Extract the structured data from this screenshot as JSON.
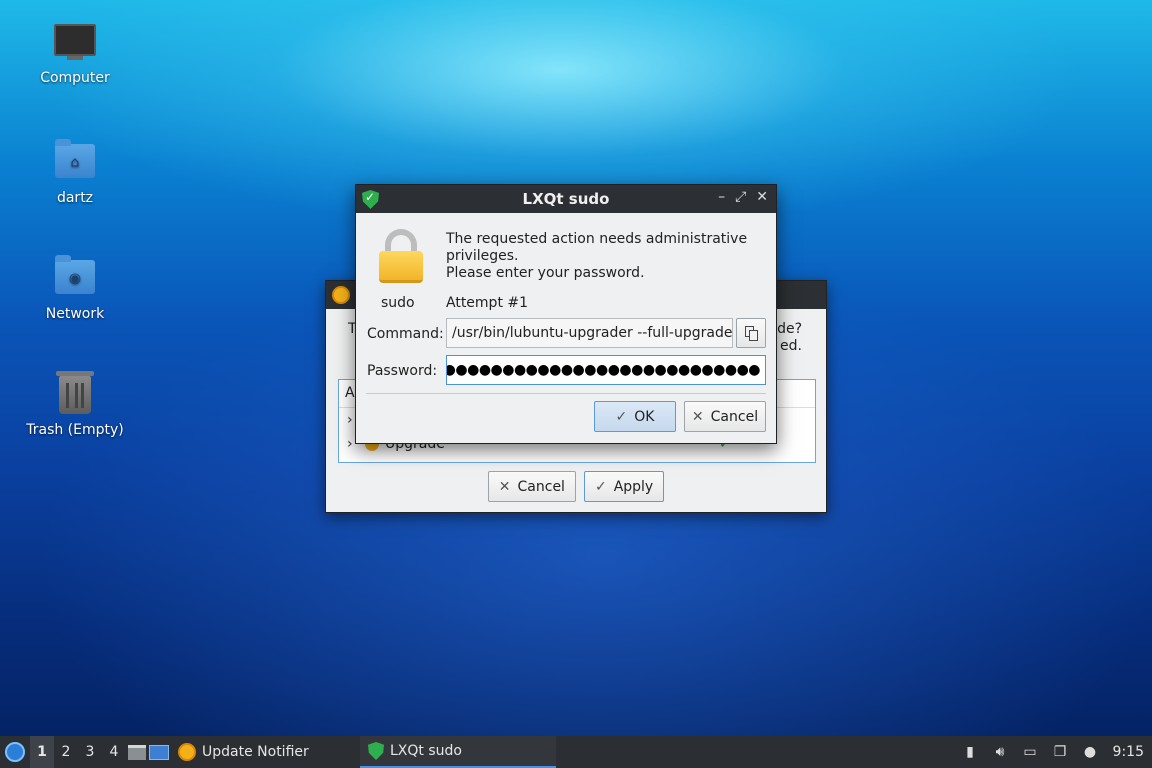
{
  "desktop": {
    "icons": [
      {
        "label": "Computer"
      },
      {
        "label": "dartz"
      },
      {
        "label": "Network"
      },
      {
        "label": "Trash (Empty)"
      }
    ]
  },
  "update_window": {
    "text_left": "T",
    "text_right_1": "ade?",
    "text_right_2": "ed.",
    "tree_header": "A",
    "rows": [
      {
        "label": ""
      },
      {
        "label": "Upgrade",
        "status": "✓"
      }
    ],
    "cancel_label": "Cancel",
    "apply_label": "Apply"
  },
  "sudo_dialog": {
    "title": "LXQt sudo",
    "message_line1": "The requested action needs administrative",
    "message_line2": "privileges.",
    "message_line3": "Please enter your password.",
    "icon_label": "sudo",
    "attempt": "Attempt #1",
    "command_label": "Command:",
    "command_value": "/usr/bin/lubuntu-upgrader --full-upgrade",
    "password_label": "Password:",
    "password_mask": "●●●●●●●●●●●●●●●●●●●●●●●●●●●",
    "ok_label": "OK",
    "cancel_label": "Cancel"
  },
  "taskbar": {
    "desktops": [
      "1",
      "2",
      "3",
      "4"
    ],
    "tasks": [
      {
        "label": "Update Notifier"
      },
      {
        "label": "LXQt sudo"
      }
    ],
    "clock": "9:15"
  }
}
